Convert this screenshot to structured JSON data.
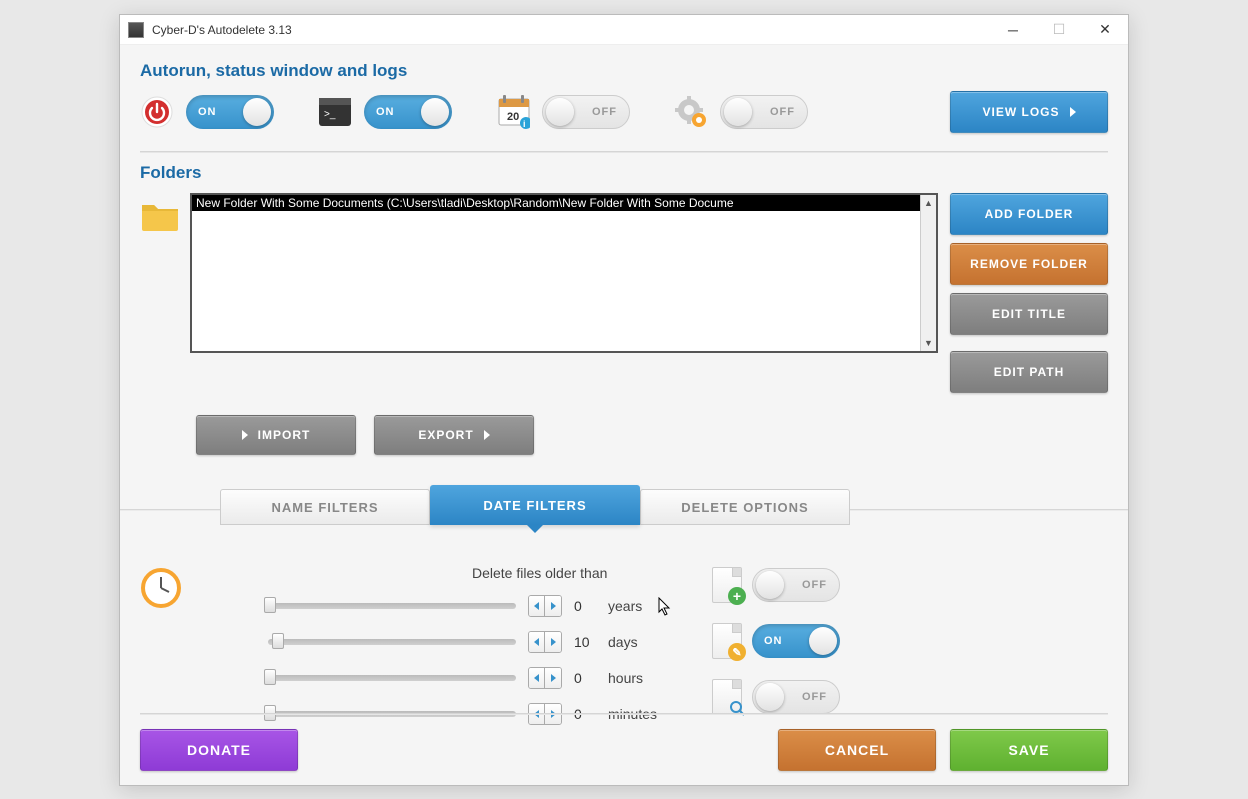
{
  "window": {
    "title": "Cyber-D's Autodelete 3.13"
  },
  "sections": {
    "autorun": {
      "title": "Autorun, status window and logs",
      "toggles": [
        {
          "icon": "power",
          "state": "on",
          "label": "ON"
        },
        {
          "icon": "terminal",
          "state": "on",
          "label": "ON"
        },
        {
          "icon": "calendar",
          "state": "off",
          "label": "OFF"
        },
        {
          "icon": "gear",
          "state": "off",
          "label": "OFF"
        }
      ],
      "view_logs": "VIEW LOGS"
    },
    "folders": {
      "title": "Folders",
      "items": [
        "New Folder With Some Documents   (C:\\Users\\tladi\\Desktop\\Random\\New Folder With Some Docume"
      ],
      "buttons": {
        "add": "ADD FOLDER",
        "remove": "REMOVE FOLDER",
        "edit_title": "EDIT TITLE",
        "edit_path": "EDIT PATH",
        "import": "IMPORT",
        "export": "EXPORT"
      }
    },
    "tabs": {
      "items": [
        "NAME FILTERS",
        "DATE FILTERS",
        "DELETE OPTIONS"
      ],
      "active": 1
    },
    "date_filters": {
      "title": "Delete files older than",
      "rows": [
        {
          "value": "0",
          "unit": "years",
          "pos": 0
        },
        {
          "value": "10",
          "unit": "days",
          "pos": 8
        },
        {
          "value": "0",
          "unit": "hours",
          "pos": 0
        },
        {
          "value": "0",
          "unit": "minutes",
          "pos": 0
        }
      ],
      "file_toggles": [
        {
          "badge": "+",
          "badge_color": "#4caf50",
          "state": "off",
          "label": "OFF"
        },
        {
          "badge": "✎",
          "badge_color": "#f0b030",
          "state": "on",
          "label": "ON"
        },
        {
          "badge": "🔍",
          "badge_color": "#3792cb",
          "state": "off",
          "label": "OFF"
        }
      ]
    },
    "footer": {
      "donate": "DONATE",
      "cancel": "CANCEL",
      "save": "SAVE"
    }
  }
}
